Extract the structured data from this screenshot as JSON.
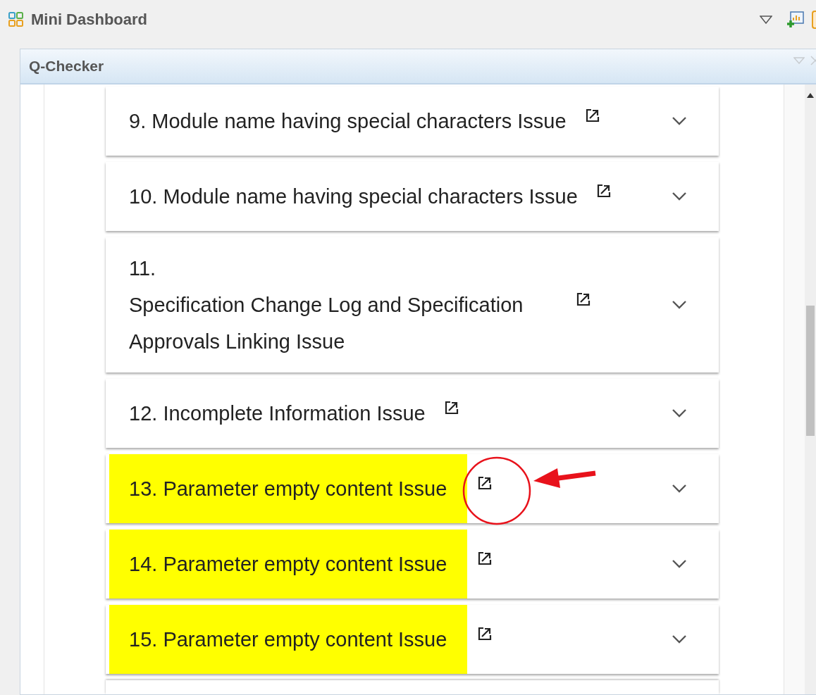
{
  "window": {
    "title": "Mini Dashboard"
  },
  "view": {
    "title": "Q-Checker"
  },
  "issues": [
    {
      "number": "9.",
      "title": "Module name having special characters Issue",
      "kind": "inline",
      "highlighted": false,
      "annotated": false
    },
    {
      "number": "10.",
      "title": "Module name having special characters Issue",
      "kind": "inline",
      "highlighted": false,
      "annotated": false
    },
    {
      "number": "11.",
      "title": "Specification Change Log and Specification Approvals Linking Issue",
      "kind": "stacked",
      "highlighted": false,
      "annotated": false
    },
    {
      "number": "12.",
      "title": "Incomplete Information Issue",
      "kind": "inline",
      "highlighted": false,
      "annotated": false
    },
    {
      "number": "13.",
      "title": "Parameter empty content Issue",
      "kind": "inline",
      "highlighted": true,
      "annotated": true
    },
    {
      "number": "14.",
      "title": "Parameter empty content Issue",
      "kind": "inline",
      "highlighted": true,
      "annotated": false
    },
    {
      "number": "15.",
      "title": "Parameter empty content Issue",
      "kind": "inline",
      "highlighted": true,
      "annotated": false
    }
  ]
}
